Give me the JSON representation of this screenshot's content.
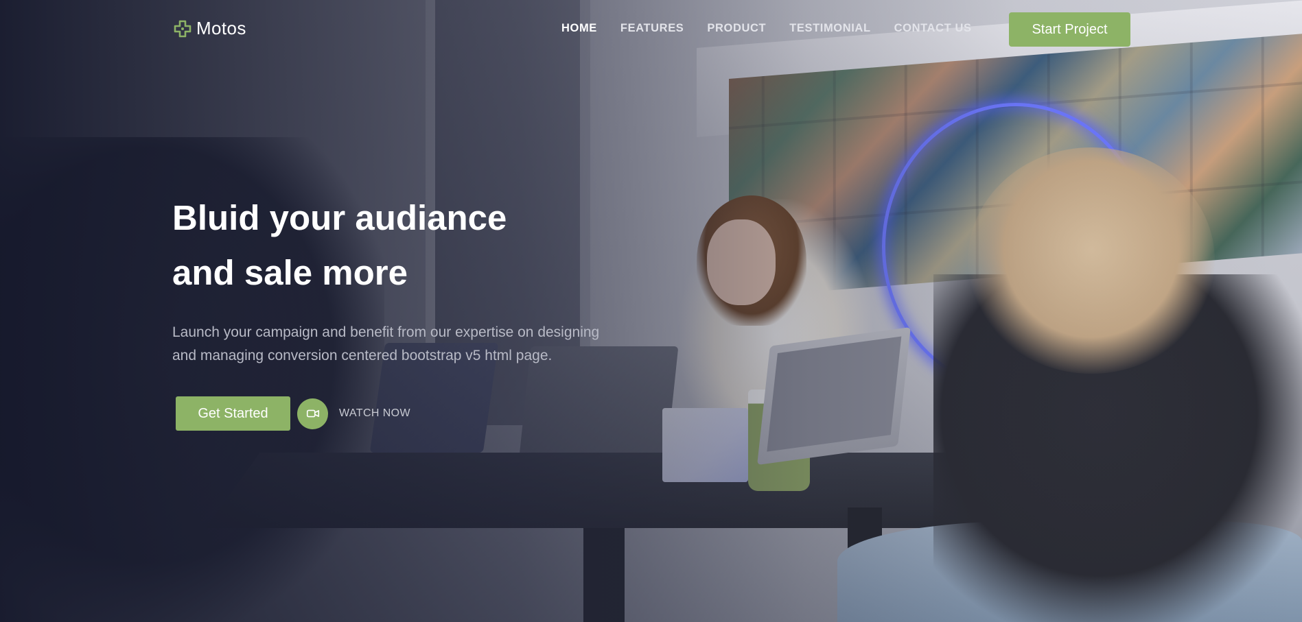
{
  "brand": {
    "name": "Motos",
    "icon": "plus-cross-icon",
    "icon_color": "#8db366"
  },
  "nav": {
    "items": [
      {
        "label": "HOME",
        "active": true
      },
      {
        "label": "FEATURES",
        "active": false
      },
      {
        "label": "PRODUCT",
        "active": false
      },
      {
        "label": "TESTIMONIAL",
        "active": false
      },
      {
        "label": "CONTACT US",
        "active": false
      }
    ],
    "cta_label": "Start Project"
  },
  "hero": {
    "title_lines": [
      "Bluid your audiance",
      "and sale more"
    ],
    "description_lines": [
      "Launch your campaign and benefit from our expertise on designing",
      "and managing conversion centered bootstrap v5 html page."
    ],
    "primary_button": "Get Started",
    "watch_label": "WATCH NOW",
    "watch_icon": "video-camera-icon"
  },
  "colors": {
    "accent": "#8db366",
    "overlay": "#16192c",
    "text_primary": "#ffffff",
    "text_muted": "#b8bac6"
  }
}
